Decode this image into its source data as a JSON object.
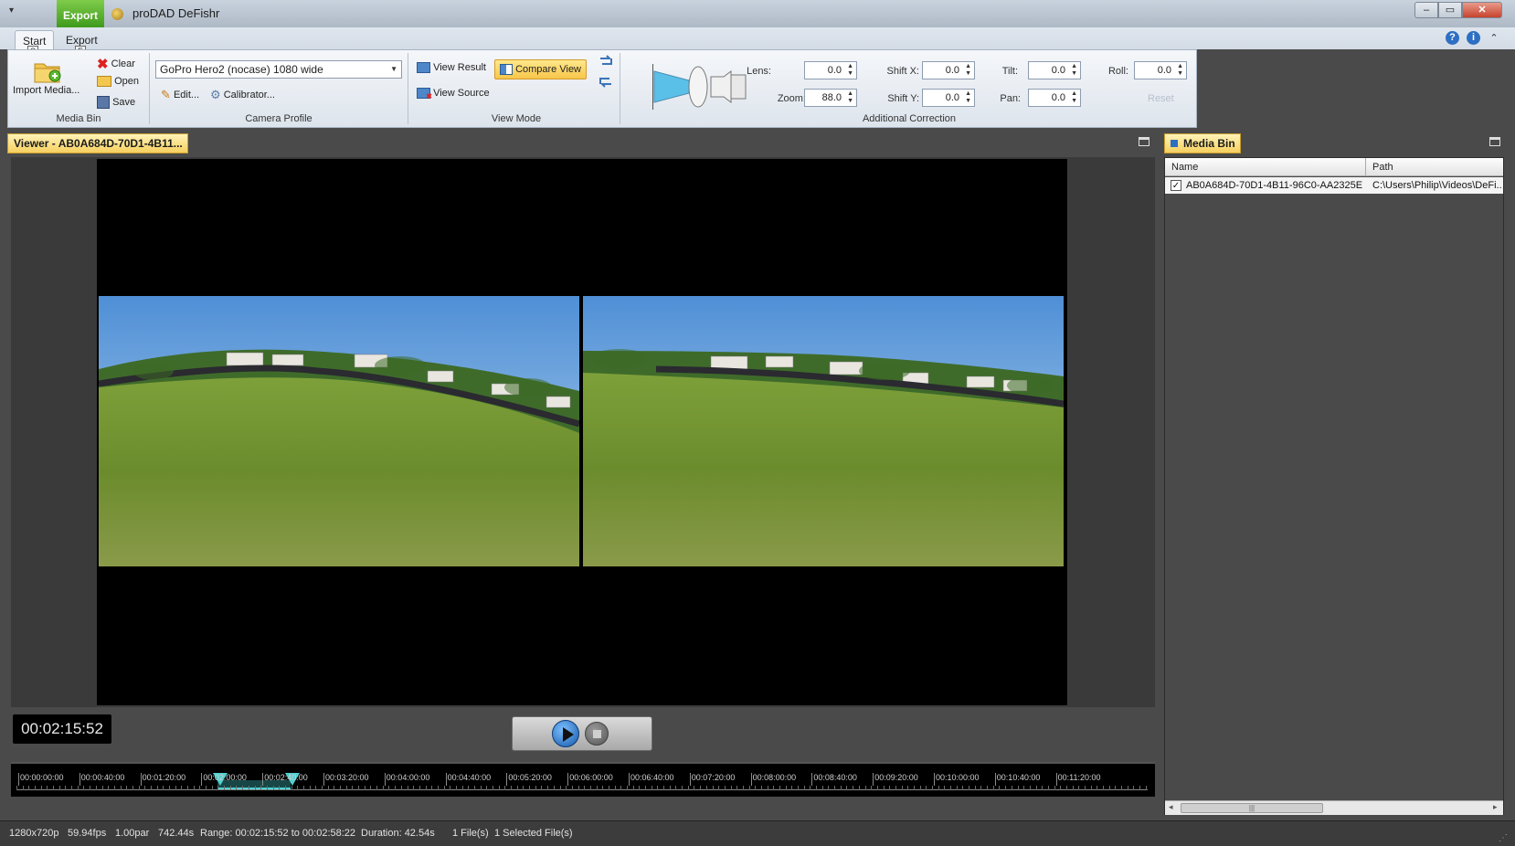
{
  "window": {
    "title": "proDAD DeFishr",
    "context_tab": "Export",
    "minimize": "–",
    "maximize": "▭",
    "close": "✕"
  },
  "ribbon_tabs": [
    {
      "label": "Start",
      "keytip": "S"
    },
    {
      "label": "Export",
      "keytip": "E"
    }
  ],
  "help": {
    "help_glyph": "?",
    "info_glyph": "i",
    "collapse_glyph": "⌃"
  },
  "media_bin_group": {
    "label": "Media Bin",
    "import": "Import Media...",
    "clear": "Clear",
    "open": "Open",
    "save": "Save"
  },
  "camera_profile_group": {
    "label": "Camera Profile",
    "selected": "GoPro Hero2 (nocase) 1080 wide",
    "edit": "Edit...",
    "calibrator": "Calibrator..."
  },
  "view_mode_group": {
    "label": "View Mode",
    "view_result": "View Result",
    "compare_view": "Compare View",
    "view_source": "View Source"
  },
  "additional_correction": {
    "label": "Additional Correction",
    "lens": {
      "label": "Lens:",
      "value": "0.0"
    },
    "zoom": {
      "label": "Zoom:",
      "value": "88.0"
    },
    "shift_x": {
      "label": "Shift X:",
      "value": "0.0"
    },
    "shift_y": {
      "label": "Shift Y:",
      "value": "0.0"
    },
    "tilt": {
      "label": "Tilt:",
      "value": "0.0"
    },
    "pan": {
      "label": "Pan:",
      "value": "0.0"
    },
    "roll": {
      "label": "Roll:",
      "value": "0.0"
    },
    "reset": "Reset"
  },
  "viewer": {
    "tab_label": "Viewer - AB0A684D-70D1-4B11...",
    "timecode": "00:02:15:52"
  },
  "timeline": {
    "ticks": [
      "00:00:00:00",
      "00:00:40:00",
      "00:01:20:00",
      "00:02:00:00",
      "00:02:40:00",
      "00:03:20:00",
      "00:04:00:00",
      "00:04:40:00",
      "00:05:20:00",
      "00:06:00:00",
      "00:06:40:00",
      "00:07:20:00",
      "00:08:00:00",
      "00:08:40:00",
      "00:09:20:00",
      "00:10:00:00",
      "00:10:40:00",
      "00:11:20:00"
    ]
  },
  "media_bin_panel": {
    "tab_label": "Media Bin",
    "columns": {
      "name": "Name",
      "path": "Path"
    },
    "rows": [
      {
        "checked": "✓",
        "name": "AB0A684D-70D1-4B11-96C0-AA2325E...",
        "path": "C:\\Users\\Philip\\Videos\\DeFi..."
      }
    ],
    "scroll_left": "◂",
    "scroll_right": "▸",
    "scroll_thumb": "|||"
  },
  "status": {
    "resolution": "1280x720p",
    "fps": "59.94fps",
    "par": "1.00par",
    "length": "742.44s",
    "range": "Range: 00:02:15:52 to 00:02:58:22",
    "duration": "Duration: 42.54s",
    "files": "1 File(s)",
    "selected": "1 Selected File(s)"
  },
  "colors": {
    "accent_export": "#3f9a1c",
    "compare_active": "#f7c64a",
    "timeline_marker": "#4fd0d0"
  }
}
